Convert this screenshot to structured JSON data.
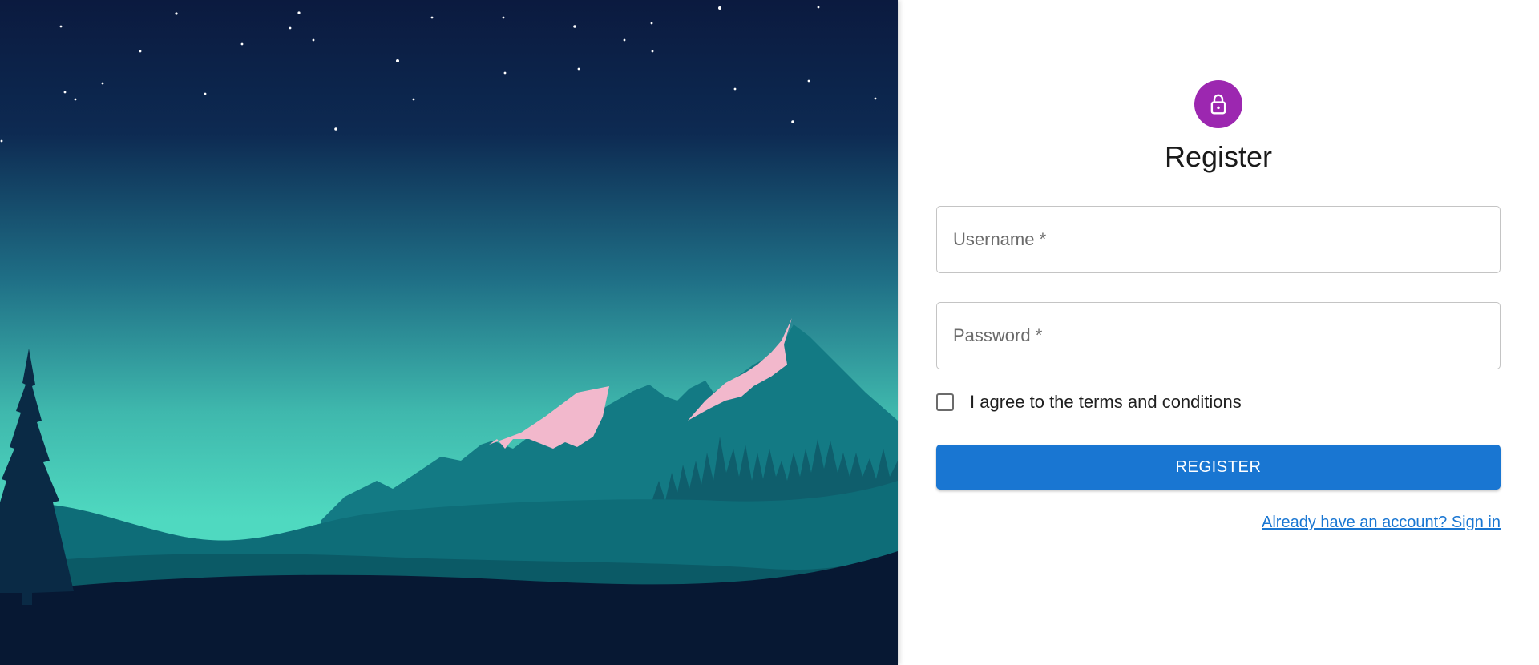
{
  "register": {
    "title": "Register",
    "icon": "lock-icon",
    "accent_color": "#9c27b0",
    "fields": {
      "username": {
        "placeholder": "Username *",
        "value": ""
      },
      "password": {
        "placeholder": "Password *",
        "value": ""
      }
    },
    "terms": {
      "label": "I agree to the terms and conditions",
      "checked": false
    },
    "submit_label": "REGISTER",
    "submit_color": "#1976d2",
    "signin_link": "Already have an account? Sign in"
  },
  "hero": {
    "description_icon": "landscape-illustration",
    "colors": {
      "sky_top": "#0b1a3f",
      "sky_horizon": "#4fd9c0",
      "mountain": "#137a84",
      "snow": "#f2b8cc",
      "ground": "#071833"
    }
  }
}
